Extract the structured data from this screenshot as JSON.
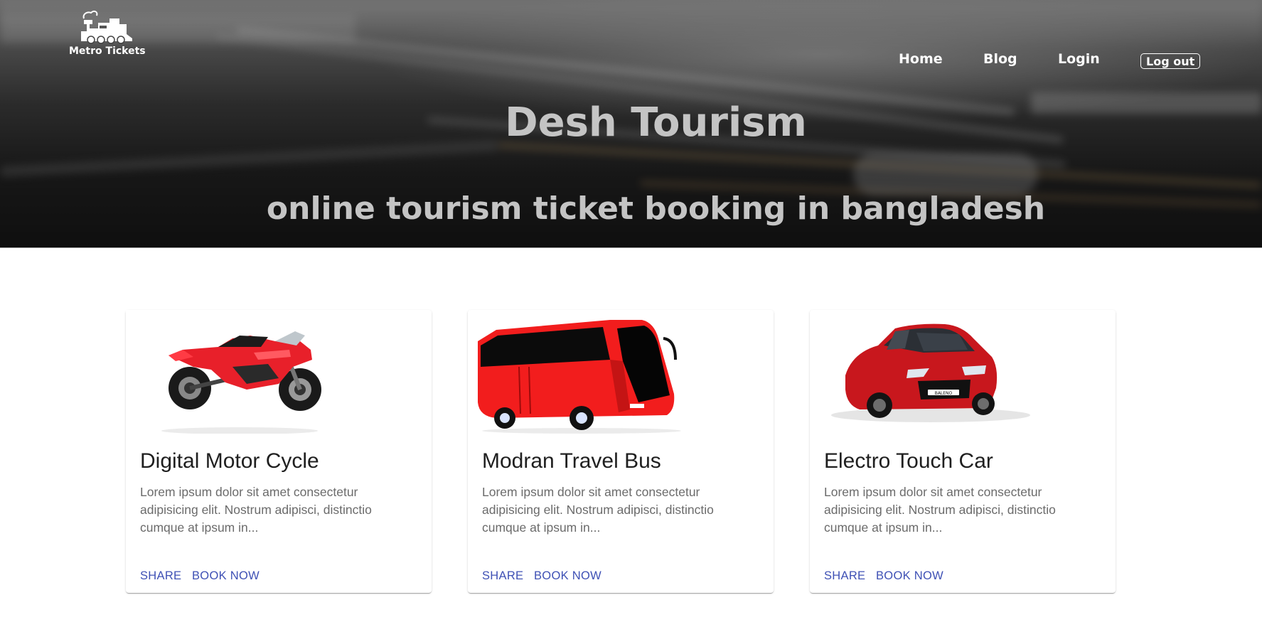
{
  "brand": {
    "name": "Metro Tickets",
    "icon": "train-icon"
  },
  "nav": {
    "home": "Home",
    "blog": "Blog",
    "login": "Login",
    "logout": "Log out"
  },
  "hero": {
    "title": "Desh Tourism",
    "subtitle": "online tourism ticket booking in bangladesh"
  },
  "cards": [
    {
      "title": "Digital Motor Cycle",
      "text": "Lorem ipsum dolor sit amet consectetur adipisicing elit. Nostrum adipisci, distinctio cumque at ipsum in...",
      "share": "SHARE",
      "book": "BOOK NOW",
      "image": "motorcycle-image"
    },
    {
      "title": "Modran Travel Bus",
      "text": "Lorem ipsum dolor sit amet consectetur adipisicing elit. Nostrum adipisci, distinctio cumque at ipsum in...",
      "share": "SHARE",
      "book": "BOOK NOW",
      "image": "bus-image"
    },
    {
      "title": "Electro Touch Car",
      "text": "Lorem ipsum dolor sit amet consectetur adipisicing elit. Nostrum adipisci, distinctio cumque at ipsum in...",
      "share": "SHARE",
      "book": "BOOK NOW",
      "image": "car-image",
      "car_plate": "BALENO"
    }
  ],
  "colors": {
    "accent": "#3f51b5",
    "hero_text": "#c4c4c4",
    "vehicle_red": "#e8202a"
  }
}
